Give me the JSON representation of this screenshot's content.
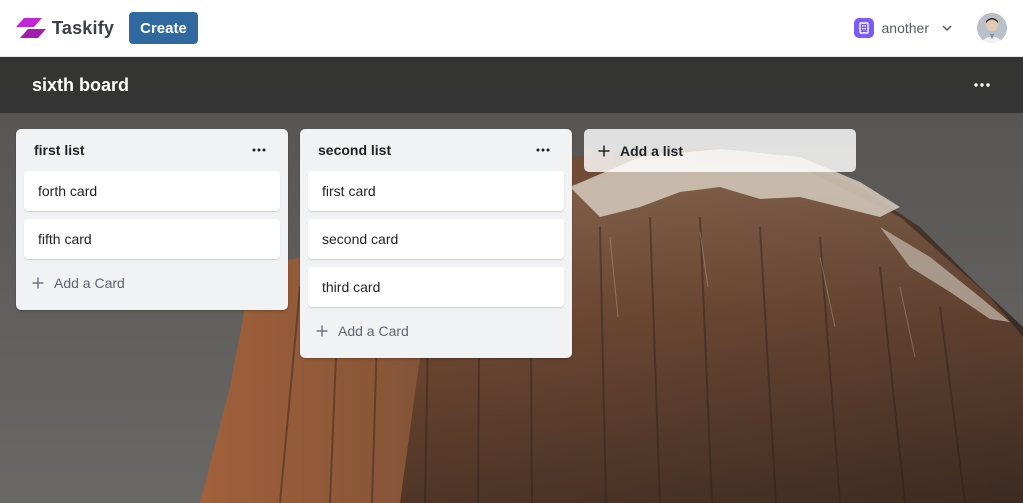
{
  "navbar": {
    "logo_text": "Taskify",
    "create_label": "Create",
    "org_name": "another",
    "org_icon": "building-icon",
    "brand_color": "#2f69a0",
    "org_color": "#7b5cf5"
  },
  "board": {
    "title": "sixth board",
    "menu_icon": "more-horizontal-icon"
  },
  "lists": [
    {
      "title": "first list",
      "cards": [
        "forth card",
        "fifth card"
      ],
      "add_card_label": "Add a Card"
    },
    {
      "title": "second list",
      "cards": [
        "first card",
        "second card",
        "third card"
      ],
      "add_card_label": "Add a Card"
    }
  ],
  "add_list_label": "Add a list"
}
